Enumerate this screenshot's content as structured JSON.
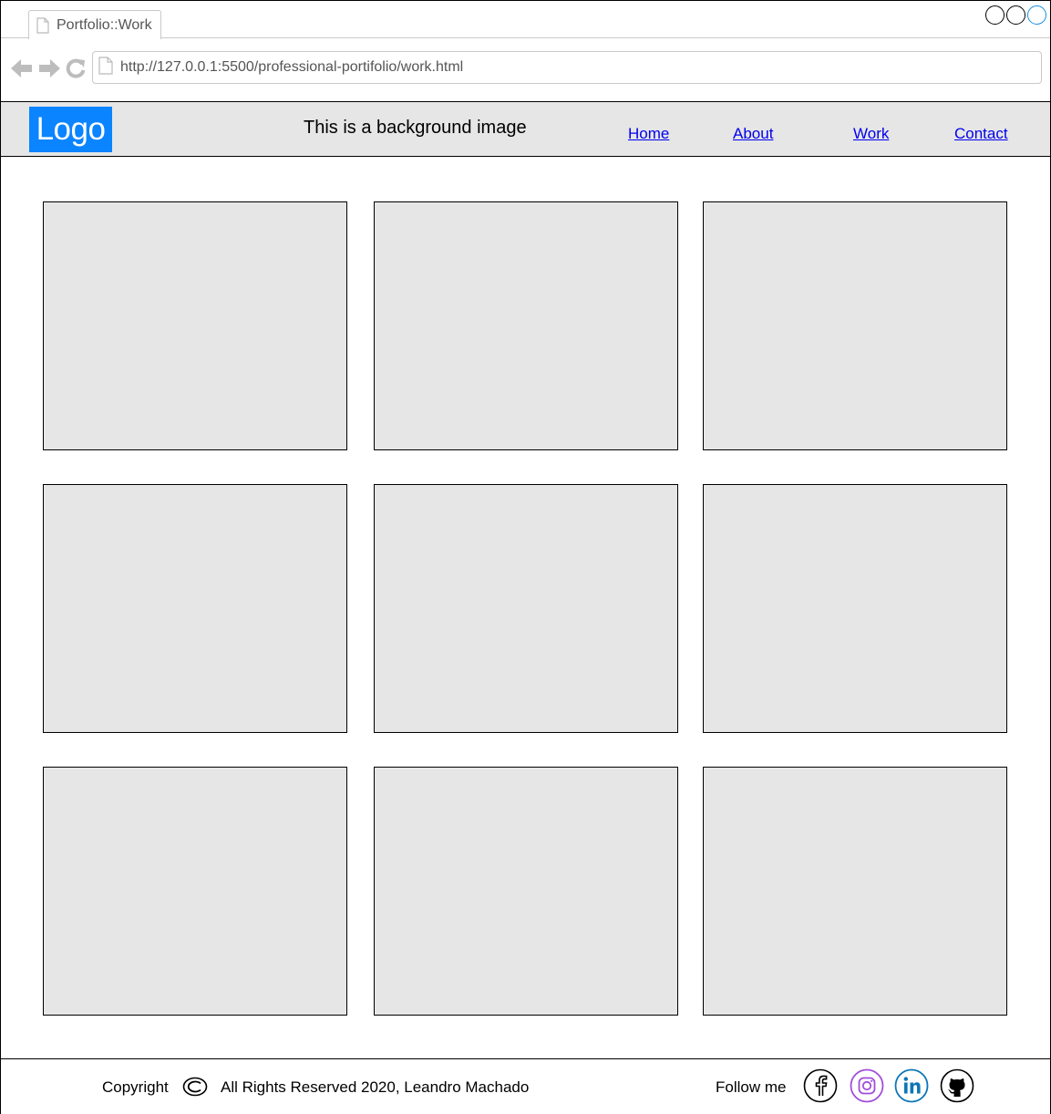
{
  "browser": {
    "tab_title": "Portfolio::Work",
    "url": "http://127.0.0.1:5500/professional-portifolio/work.html",
    "window_controls": [
      "minimize",
      "maximize",
      "close"
    ],
    "accent_color": "#1b8fe0"
  },
  "header": {
    "logo": "Logo",
    "logo_color": "#0a84ff",
    "background_text": "This is a background image",
    "nav": {
      "home": "Home",
      "about": "About",
      "work": "Work",
      "contact": "Contact"
    }
  },
  "work_grid": {
    "rows": 3,
    "columns": 3,
    "placeholder_color": "#e6e6e6"
  },
  "footer": {
    "copyright_label": "Copyright",
    "copyright_icon": "copyright-icon",
    "rights_text": "All Rights Reserved 2020, Leandro Machado",
    "follow_label": "Follow me",
    "social": [
      {
        "name": "facebook-icon",
        "color": "#000000"
      },
      {
        "name": "instagram-icon",
        "color": "#a24ddb"
      },
      {
        "name": "linkedin-icon",
        "color": "#0e76b6"
      },
      {
        "name": "github-icon",
        "color": "#000000"
      }
    ]
  }
}
